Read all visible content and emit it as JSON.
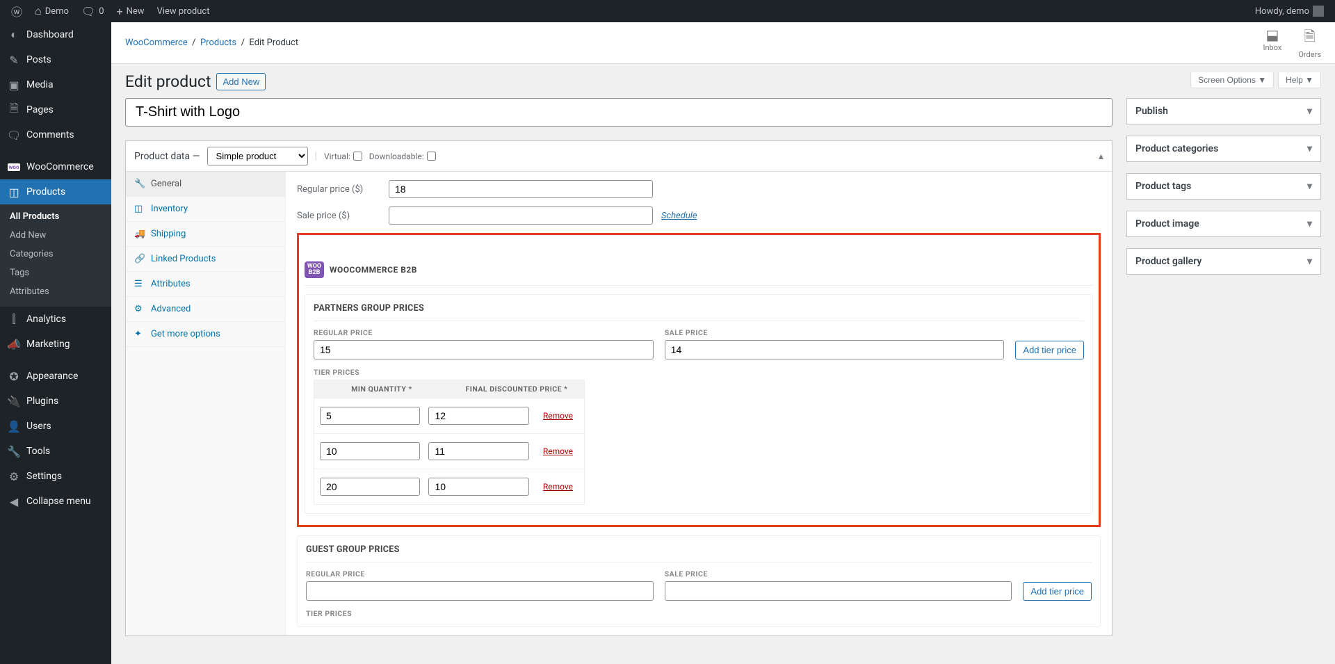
{
  "adminbar": {
    "site": "Demo",
    "comments": "0",
    "new": "New",
    "view_product": "View product",
    "howdy": "Howdy, demo"
  },
  "sidebar": {
    "items": [
      {
        "icon": "◐",
        "label": "Dashboard"
      },
      {
        "icon": "✎",
        "label": "Posts"
      },
      {
        "icon": "▣",
        "label": "Media"
      },
      {
        "icon": "🗎",
        "label": "Pages"
      },
      {
        "icon": "🗨",
        "label": "Comments"
      },
      {
        "icon": "woo",
        "label": "WooCommerce"
      },
      {
        "icon": "◫",
        "label": "Products"
      },
      {
        "icon": "⫿",
        "label": "Analytics"
      },
      {
        "icon": "📣",
        "label": "Marketing"
      },
      {
        "icon": "✪",
        "label": "Appearance"
      },
      {
        "icon": "🔌",
        "label": "Plugins"
      },
      {
        "icon": "👤",
        "label": "Users"
      },
      {
        "icon": "🔧",
        "label": "Tools"
      },
      {
        "icon": "⚙",
        "label": "Settings"
      },
      {
        "icon": "◀",
        "label": "Collapse menu"
      }
    ],
    "submenu": [
      "All Products",
      "Add New",
      "Categories",
      "Tags",
      "Attributes"
    ]
  },
  "breadcrumb": {
    "a": "WooCommerce",
    "b": "Products",
    "c": "Edit Product"
  },
  "top_actions": {
    "inbox": "Inbox",
    "orders": "Orders"
  },
  "page": {
    "title": "Edit product",
    "add_new": "Add New",
    "screen_options": "Screen Options",
    "help": "Help"
  },
  "product": {
    "title": "T-Shirt with Logo"
  },
  "pd": {
    "heading": "Product data —",
    "type": "Simple product",
    "virtual": "Virtual:",
    "downloadable": "Downloadable:",
    "tabs": [
      "General",
      "Inventory",
      "Shipping",
      "Linked Products",
      "Attributes",
      "Advanced",
      "Get more options"
    ],
    "tab_icons": [
      "🔧",
      "◫",
      "🚚",
      "🔗",
      "☰",
      "⚙",
      "✦"
    ],
    "regular_label": "Regular price ($)",
    "regular_value": "18",
    "sale_label": "Sale price ($)",
    "sale_value": "",
    "schedule": "Schedule"
  },
  "b2b": {
    "badge_top": "WOO",
    "badge_bot": "B2B",
    "title": "WOOCOMMERCE B2B",
    "add_tier": "Add tier price",
    "remove": "Remove",
    "col_qty": "MIN QUANTITY *",
    "col_price": "FINAL DISCOUNTED PRICE *",
    "reg_label": "REGULAR PRICE",
    "sale_label": "SALE PRICE",
    "tier_label": "TIER PRICES",
    "groups": [
      {
        "name": "PARTNERS GROUP PRICES",
        "regular": "15",
        "sale": "14",
        "tiers": [
          {
            "qty": "5",
            "price": "12"
          },
          {
            "qty": "10",
            "price": "11"
          },
          {
            "qty": "20",
            "price": "10"
          }
        ]
      },
      {
        "name": "GUEST GROUP PRICES",
        "regular": "",
        "sale": "",
        "tiers": []
      }
    ]
  },
  "side": {
    "boxes": [
      "Publish",
      "Product categories",
      "Product tags",
      "Product image",
      "Product gallery"
    ]
  }
}
